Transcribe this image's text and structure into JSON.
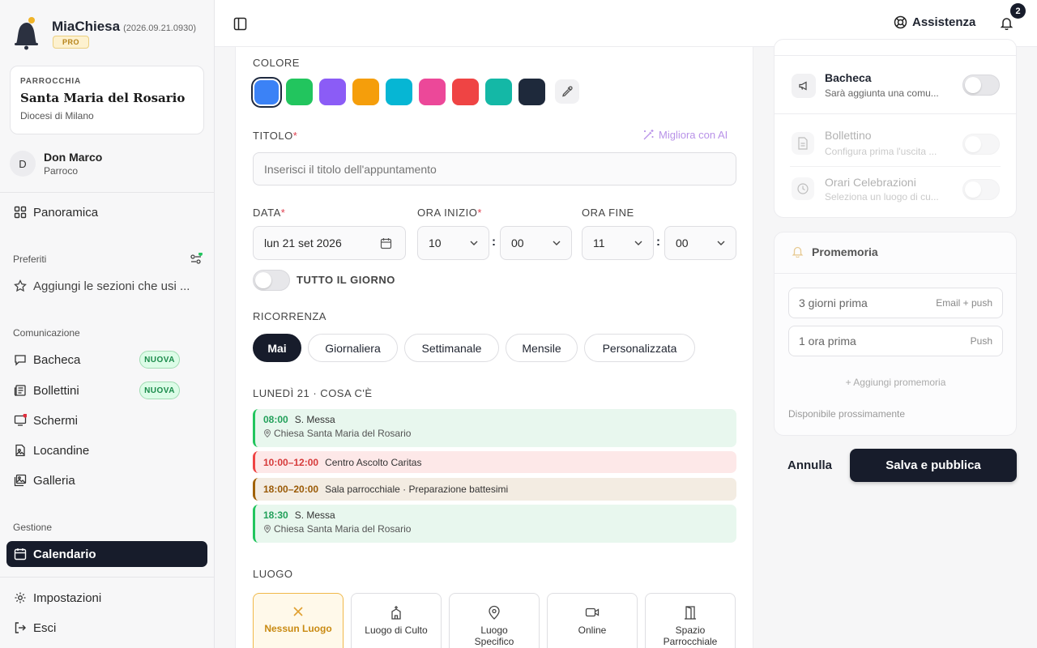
{
  "app": {
    "name": "MiaChiesa",
    "version": "(2026.09.21.0930)",
    "plan": "PRO"
  },
  "parish": {
    "kicker": "PARROCCHIA",
    "name": "Santa Maria del Rosario",
    "diocese": "Diocesi di Milano"
  },
  "user": {
    "initial": "D",
    "name": "Don Marco",
    "role": "Parroco"
  },
  "nav": {
    "overview": "Panoramica",
    "favorites_title": "Preferiti",
    "favorites_add": "Aggiungi le sezioni che usi ...",
    "comm_title": "Comunicazione",
    "bacheca": "Bacheca",
    "bacheca_badge": "NUOVA",
    "bollettini": "Bollettini",
    "bollettini_badge": "NUOVA",
    "schermi": "Schermi",
    "locandine": "Locandine",
    "galleria": "Galleria",
    "manage_title": "Gestione",
    "calendario": "Calendario",
    "impostazioni": "Impostazioni",
    "esci": "Esci"
  },
  "topbar": {
    "help": "Assistenza",
    "notifications": "2"
  },
  "form": {
    "color_label": "COLORE",
    "colors": [
      "#3b82f6",
      "#22c55e",
      "#8b5cf6",
      "#f59e0b",
      "#06b6d4",
      "#ec4899",
      "#ef4444",
      "#14b8a6",
      "#1e293b"
    ],
    "title_label": "TITOLO",
    "required": "*",
    "ai_improve": "Migliora con AI",
    "title_placeholder": "Inserisci il titolo dell'appuntamento",
    "date_label": "DATA",
    "date_value": "lun 21 set 2026",
    "start_label": "ORA INIZIO",
    "start_hour": "10",
    "start_min": "00",
    "end_label": "ORA FINE",
    "end_hour": "11",
    "end_min": "00",
    "time_sep": ":",
    "all_day": "TUTTO IL GIORNO",
    "recurrence_label": "RICORRENZA",
    "recurrence": [
      "Mai",
      "Giornaliera",
      "Settimanale",
      "Mensile",
      "Personalizzata"
    ],
    "day_label": "LUNEDÌ 21 · COSA C'È",
    "events": [
      {
        "time": "08:00",
        "title": "S. Messa",
        "location": "Chiesa Santa Maria del Rosario",
        "color": "#22c55e"
      },
      {
        "time": "10:00–12:00",
        "title": "Centro Ascolto Caritas",
        "color": "#ef4444"
      },
      {
        "time": "18:00–20:00",
        "title": "Sala parrocchiale · Preparazione battesimi",
        "color": "#a16207"
      },
      {
        "time": "18:30",
        "title": "S. Messa",
        "location": "Chiesa Santa Maria del Rosario",
        "color": "#22c55e"
      }
    ],
    "place_label": "LUOGO",
    "places": [
      "Nessun Luogo",
      "Luogo di Culto",
      "Luogo Specifico",
      "Online",
      "Spazio Parrocchiale"
    ]
  },
  "publish": {
    "bacheca_title": "Bacheca",
    "bacheca_sub": "Sarà aggiunta una comu...",
    "bollettino_title": "Bollettino",
    "bollettino_sub": "Configura prima l'uscita ...",
    "orari_title": "Orari Celebrazioni",
    "orari_sub": "Seleziona un luogo di cu..."
  },
  "reminders": {
    "title": "Promemoria",
    "items": [
      {
        "label": "3 giorni prima",
        "channel": "Email + push"
      },
      {
        "label": "1 ora prima",
        "channel": "Push"
      }
    ],
    "add": "+ Aggiungi promemoria",
    "note": "Disponibile prossimamente"
  },
  "actions": {
    "cancel": "Annulla",
    "save": "Salva e pubblica"
  }
}
